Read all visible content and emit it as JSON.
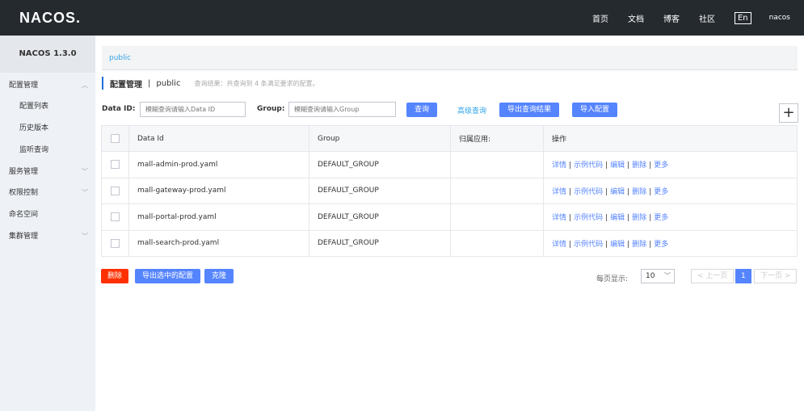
{
  "topbar": {
    "logo": "NACOS.",
    "nav": [
      "首页",
      "文档",
      "博客",
      "社区"
    ],
    "lang": "En",
    "user": "nacos"
  },
  "sidebar": {
    "version": "NACOS 1.3.0",
    "items": [
      {
        "label": "配置管理",
        "chevron": "﹀"
      },
      {
        "label": "配置列表"
      },
      {
        "label": "历史版本"
      },
      {
        "label": "监听查询"
      },
      {
        "label": "服务管理",
        "chevron": "﹀"
      },
      {
        "label": "权限控制",
        "chevron": "﹀"
      },
      {
        "label": "命名空间"
      },
      {
        "label": "集群管理",
        "chevron": "﹀"
      }
    ]
  },
  "main": {
    "namespace": "public",
    "title": "配置管理",
    "separator": "|",
    "title_ns": "public",
    "hint": "查询结果：共查询到 4 条满足要求的配置。",
    "filter": {
      "dataid_label": "Data ID:",
      "dataid_placeholder": "模糊查询请输入Data ID",
      "group_label": "Group:",
      "group_placeholder": "模糊查询请输入Group",
      "query": "查询",
      "advanced": "高级查询",
      "export": "导出查询结果",
      "import": "导入配置",
      "add": "+"
    },
    "table": {
      "headers": [
        "Data Id",
        "Group",
        "归属应用:",
        "操作"
      ],
      "rows": [
        {
          "dataid": "mall-admin-prod.yaml",
          "group": "DEFAULT_GROUP",
          "app": ""
        },
        {
          "dataid": "mall-gateway-prod.yaml",
          "group": "DEFAULT_GROUP",
          "app": ""
        },
        {
          "dataid": "mall-portal-prod.yaml",
          "group": "DEFAULT_GROUP",
          "app": ""
        },
        {
          "dataid": "mall-search-prod.yaml",
          "group": "DEFAULT_GROUP",
          "app": ""
        }
      ],
      "ops": [
        "详情",
        "示例代码",
        "编辑",
        "删除",
        "更多"
      ]
    },
    "bottom": {
      "delete": "删除",
      "export_selected": "导出选中的配置",
      "clone": "克隆",
      "pagesize_label": "每页显示:",
      "pagesize": "10",
      "prev": "< 上一页",
      "page": "1",
      "next": "下一页 >"
    }
  },
  "colors": {
    "topbar": "#252a2f",
    "sidebar": "#eef1f6",
    "primary": "#5584ff",
    "danger": "#ff3000",
    "link": "#2fa4e7"
  }
}
